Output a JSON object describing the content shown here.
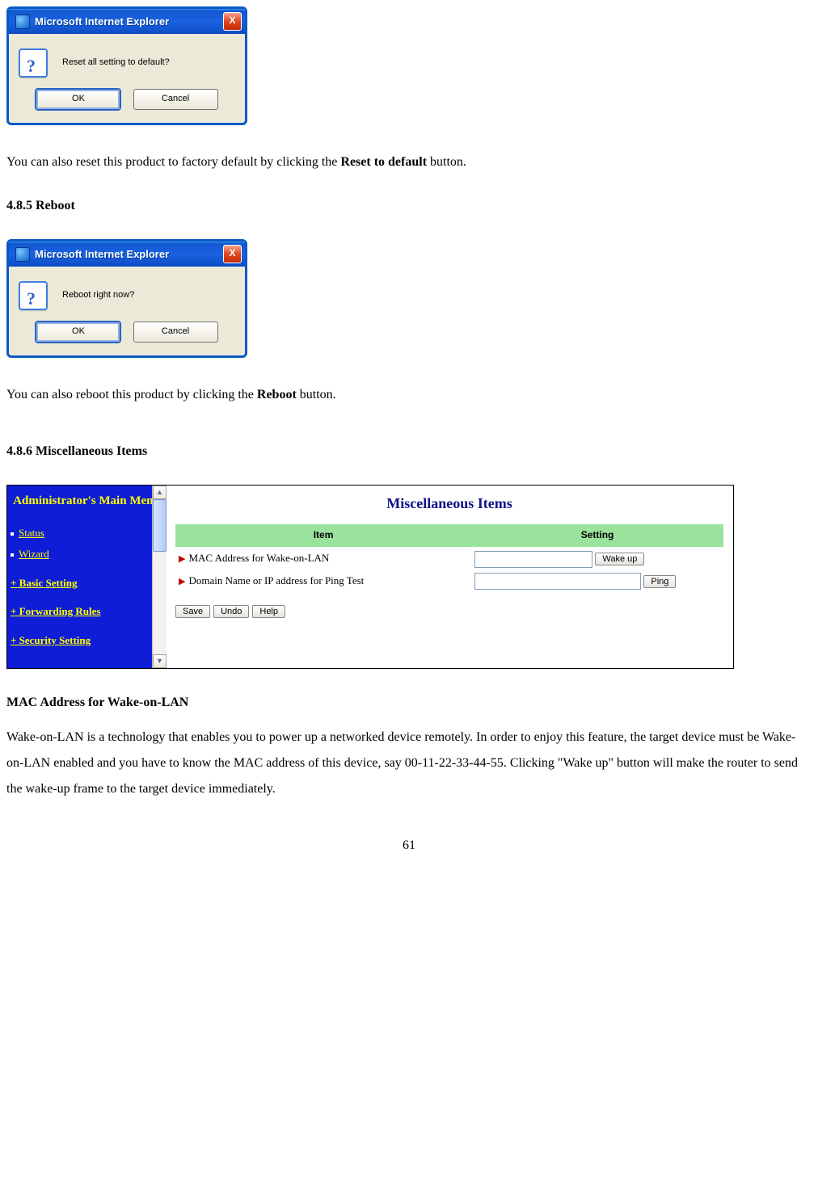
{
  "dialog1": {
    "title": "Microsoft Internet Explorer",
    "close": "X",
    "message": "Reset all setting to default?",
    "ok": "OK",
    "cancel": "Cancel"
  },
  "para1_a": "You can also reset this product to factory default by clicking the ",
  "para1_bold": "Reset to default",
  "para1_b": " button.",
  "section_reboot": "4.8.5 Reboot",
  "dialog2": {
    "title": "Microsoft Internet Explorer",
    "close": "X",
    "message": "Reboot right now?",
    "ok": "OK",
    "cancel": "Cancel"
  },
  "para2_a": "You can also reboot this product by clicking the ",
  "para2_bold": "Reboot",
  "para2_b": " button.",
  "section_misc": "4.8.6 Miscellaneous Items",
  "router": {
    "sidebar_title": "Administrator's Main Menu",
    "status": "Status",
    "wizard": "Wizard",
    "basic": "+ Basic Setting",
    "forwarding": "+ Forwarding Rules",
    "security": "+ Security Setting",
    "content_title": "Miscellaneous Items",
    "col_item": "Item",
    "col_setting": "Setting",
    "row1": "MAC Address for Wake-on-LAN",
    "btn_wake": "Wake up",
    "row2": "Domain Name or IP address for Ping Test",
    "btn_ping": "Ping",
    "btn_save": "Save",
    "btn_undo": "Undo",
    "btn_help": "Help"
  },
  "mac_head": "MAC Address for Wake-on-LAN",
  "mac_para": "Wake-on-LAN is a technology that enables you to power up a networked device remotely. In order to enjoy this feature, the target device must be Wake-on-LAN enabled and you have to know the MAC address of this device, say 00-11-22-33-44-55. Clicking \"Wake up\" button will make the router to send the wake-up frame to the target device immediately.",
  "page_no": "61"
}
